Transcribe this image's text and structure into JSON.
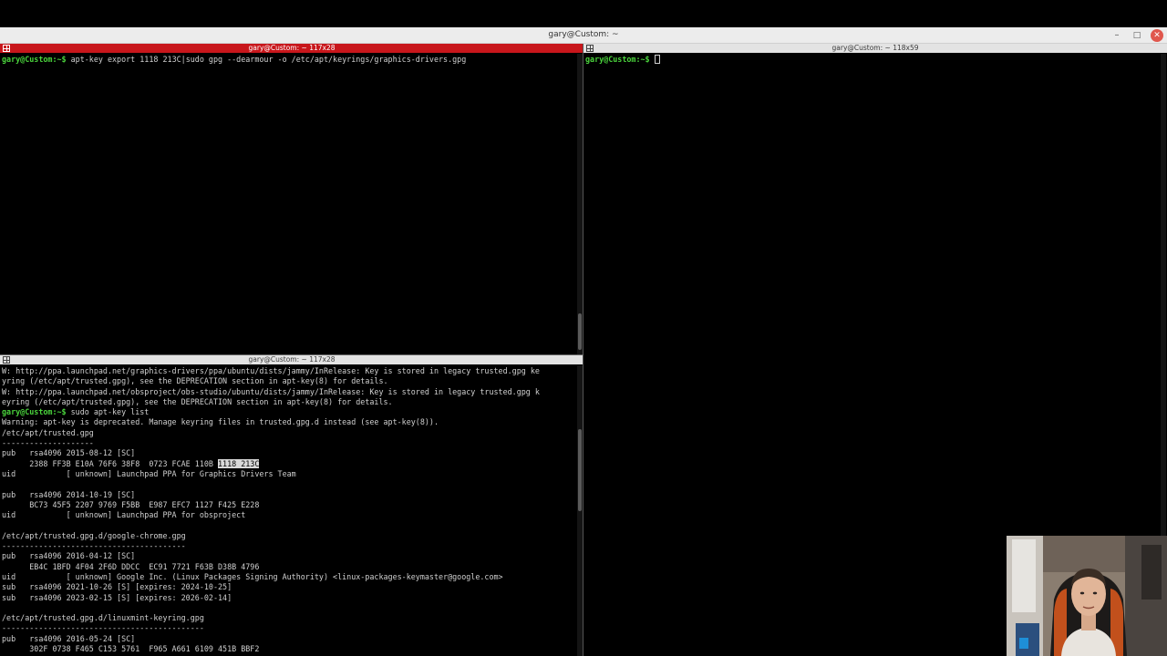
{
  "window": {
    "title": "gary@Custom: ~",
    "controls": {
      "minimize": "–",
      "maximize": "□",
      "close": "✕"
    }
  },
  "panes": {
    "top_left": {
      "title": "gary@Custom: ~ 117x28",
      "prompt": "gary@Custom:~$",
      "command": " apt-key export 1118 213C|sudo gpg --dearmour -o /etc/apt/keyrings/graphics-drivers.gpg"
    },
    "right": {
      "title": "gary@Custom: ~ 118x59",
      "prompt": "gary@Custom:~$",
      "command": " "
    },
    "bottom_left": {
      "title": "gary@Custom: ~ 117x28",
      "lines": [
        "W: http://ppa.launchpad.net/graphics-drivers/ppa/ubuntu/dists/jammy/InRelease: Key is stored in legacy trusted.gpg ke",
        "yring (/etc/apt/trusted.gpg), see the DEPRECATION section in apt-key(8) for details.",
        "W: http://ppa.launchpad.net/obsproject/obs-studio/ubuntu/dists/jammy/InRelease: Key is stored in legacy trusted.gpg k",
        "eyring (/etc/apt/trusted.gpg), see the DEPRECATION section in apt-key(8) for details."
      ],
      "prompt": "gary@Custom:~$",
      "command": " sudo apt-key list",
      "output_pre": [
        "Warning: apt-key is deprecated. Manage keyring files in trusted.gpg.d instead (see apt-key(8)).",
        "/etc/apt/trusted.gpg",
        "--------------------",
        "pub   rsa4096 2015-08-12 [SC]"
      ],
      "fingerprint_prefix": "      2388 FF3B E10A 76F6 38F8  0723 FCAE 110B ",
      "fingerprint_selected": "1118 213C",
      "output_post": [
        "uid           [ unknown] Launchpad PPA for Graphics Drivers Team",
        "",
        "pub   rsa4096 2014-10-19 [SC]",
        "      BC73 45F5 2207 9769 F5BB  E987 EFC7 1127 F425 E228",
        "uid           [ unknown] Launchpad PPA for obsproject",
        "",
        "/etc/apt/trusted.gpg.d/google-chrome.gpg",
        "----------------------------------------",
        "pub   rsa4096 2016-04-12 [SC]",
        "      EB4C 1BFD 4F04 2F6D DDCC  EC91 7721 F63B D38B 4796",
        "uid           [ unknown] Google Inc. (Linux Packages Signing Authority) <linux-packages-keymaster@google.com>",
        "sub   rsa4096 2021-10-26 [S] [expires: 2024-10-25]",
        "sub   rsa4096 2023-02-15 [S] [expires: 2026-02-14]",
        "",
        "/etc/apt/trusted.gpg.d/linuxmint-keyring.gpg",
        "--------------------------------------------",
        "pub   rsa4096 2016-05-24 [SC]",
        "      302F 0738 F465 C153 5761  F965 A661 6109 451B BBF2"
      ]
    }
  },
  "colors": {
    "prompt": "#4ad43c",
    "active_pane_header": "#c8161b",
    "terminal_bg": "#000000",
    "terminal_fg": "#d0d0d0"
  }
}
